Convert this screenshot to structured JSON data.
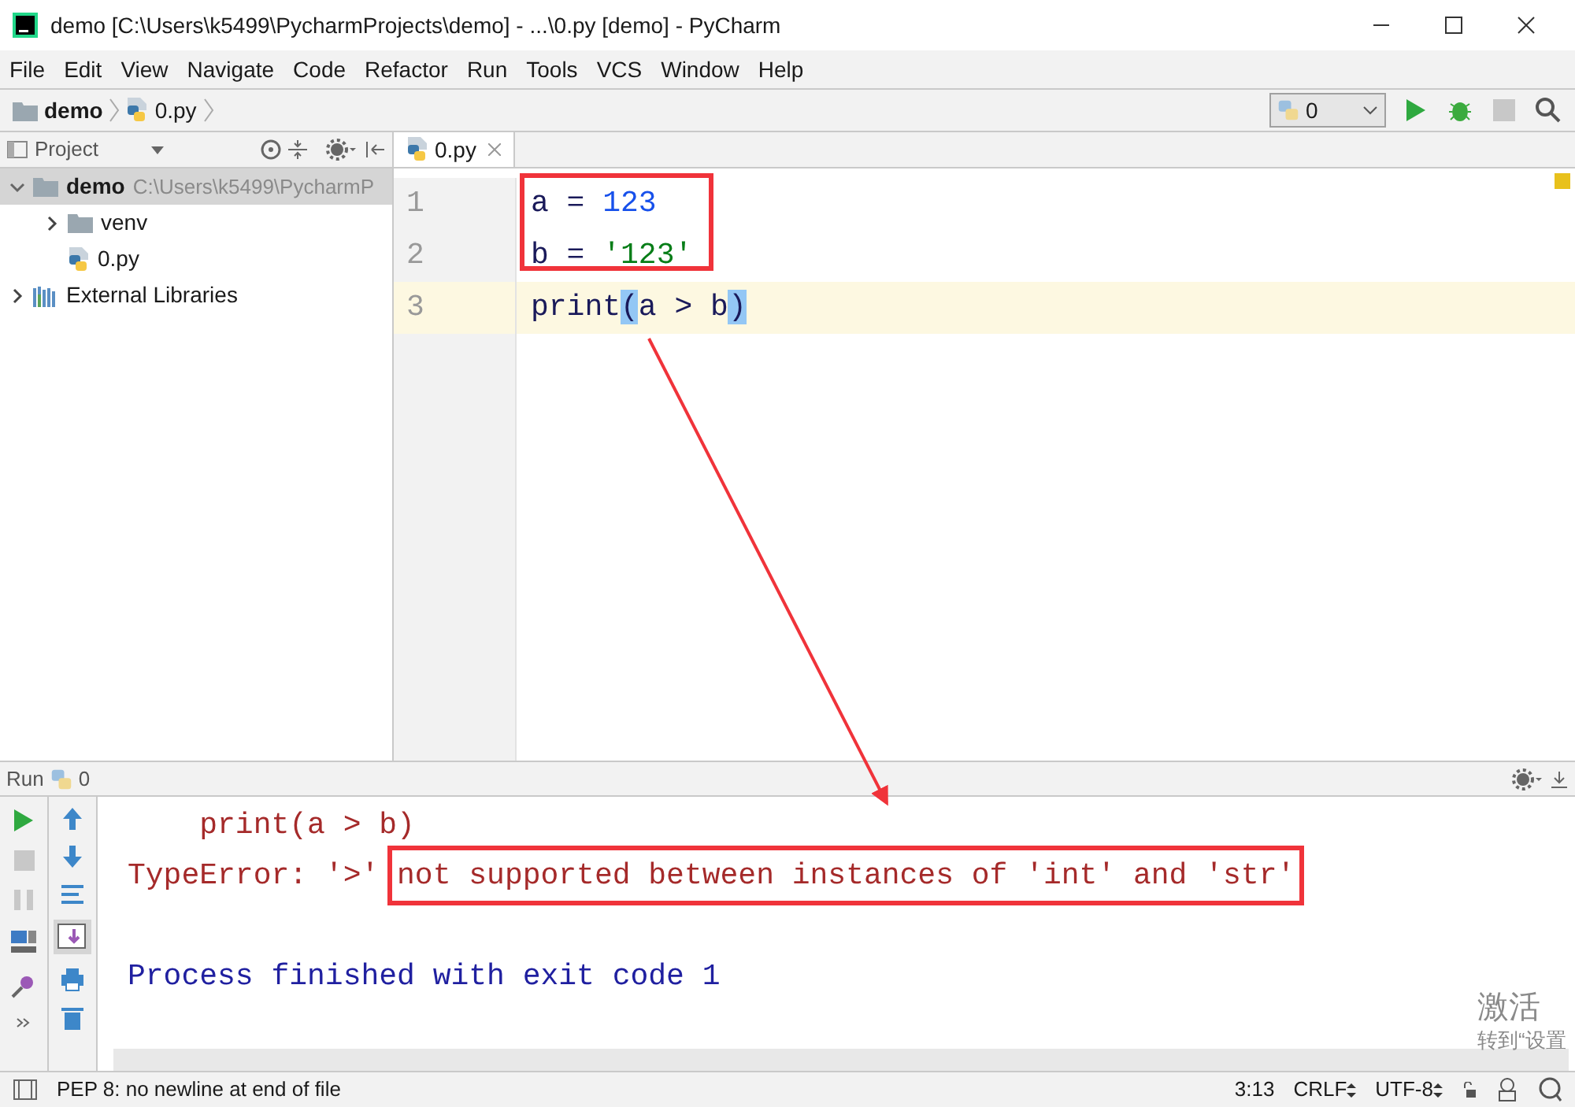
{
  "window": {
    "title": "demo [C:\\Users\\k5499\\PycharmProjects\\demo] - ...\\0.py [demo] - PyCharm"
  },
  "menu": [
    "File",
    "Edit",
    "View",
    "Navigate",
    "Code",
    "Refactor",
    "Run",
    "Tools",
    "VCS",
    "Window",
    "Help"
  ],
  "breadcrumbs": [
    {
      "label": "demo",
      "kind": "folder"
    },
    {
      "label": "0.py",
      "kind": "python"
    }
  ],
  "run_config": {
    "label": "0"
  },
  "project_panel": {
    "title": "Project",
    "tree": [
      {
        "label": "demo",
        "path": "C:\\Users\\k5499\\PycharmP",
        "kind": "folder",
        "expanded": true,
        "selected": true,
        "children": [
          {
            "label": "venv",
            "kind": "folder",
            "expanded": false,
            "selected": false
          },
          {
            "label": "0.py",
            "kind": "python",
            "selected": false
          }
        ]
      },
      {
        "label": "External Libraries",
        "kind": "library",
        "expanded": false,
        "selected": false
      }
    ]
  },
  "editor": {
    "tabs": [
      {
        "label": "0.py",
        "selected": true
      }
    ],
    "lines": [
      {
        "number": "1",
        "current": false,
        "tokens": [
          {
            "text": "a = ",
            "kind": "plain"
          },
          {
            "text": "123",
            "kind": "number"
          }
        ]
      },
      {
        "number": "2",
        "current": false,
        "tokens": [
          {
            "text": "b = ",
            "kind": "plain"
          },
          {
            "text": "'123'",
            "kind": "string"
          }
        ]
      },
      {
        "number": "3",
        "current": true,
        "tokens": [
          {
            "text": "print",
            "kind": "plain"
          },
          {
            "text": "(",
            "kind": "brace"
          },
          {
            "text": "a > b",
            "kind": "plain"
          },
          {
            "text": ")",
            "kind": "brace"
          }
        ]
      }
    ]
  },
  "run_panel": {
    "title": "Run",
    "config": "0",
    "output": [
      {
        "kind": "error",
        "segments": [
          {
            "text": "    print(a > b)",
            "boxed": false
          }
        ]
      },
      {
        "kind": "error",
        "segments": [
          {
            "text": "TypeError: '>' ",
            "boxed": false
          },
          {
            "text": "not supported between instances of 'int' and 'str'",
            "boxed": true
          }
        ]
      },
      {
        "kind": "exit",
        "segments": [
          {
            "text": "Process finished with exit code 1",
            "boxed": false
          }
        ]
      }
    ]
  },
  "status_bar": {
    "message": "PEP 8: no newline at end of file",
    "position": "3:13",
    "line_separator": "CRLF",
    "encoding": "UTF-8"
  },
  "os_overlay": [
    "激活",
    "转到“设置"
  ]
}
